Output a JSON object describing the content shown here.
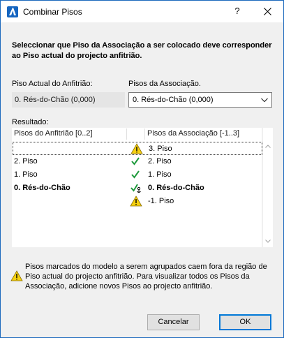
{
  "window": {
    "title": "Combinar Pisos",
    "help": "?"
  },
  "instruction": "Seleccionar que Piso da Associação a ser colocado deve corresponder ao Piso actual do projecto anfitrião.",
  "host_story": {
    "label": "Piso Actual do Anfitrião:",
    "value": "0. Rés-do-Chão (0,000)"
  },
  "assoc_story": {
    "label": "Pisos da Associação.",
    "selected": "0. Rés-do-Chão (0,000)"
  },
  "results": {
    "label": "Resultado:",
    "col_host": "Pisos do Anfitrião [0..2]",
    "col_assoc": "Pisos da Associação [-1..3]",
    "rows": [
      {
        "host": "",
        "status": "warning-icon",
        "assoc": "3. Piso",
        "bold": false
      },
      {
        "host": "2. Piso",
        "status": "check-icon",
        "assoc": "2. Piso",
        "bold": false
      },
      {
        "host": "1. Piso",
        "status": "check-icon",
        "assoc": "1. Piso",
        "bold": false
      },
      {
        "host": "0. Rés-do-Chão",
        "status": "check-anchor-icon",
        "assoc": "0. Rés-do-Chão",
        "bold": true
      },
      {
        "host": "",
        "status": "warning-icon",
        "assoc": "-1. Piso",
        "bold": false
      }
    ]
  },
  "note": "Pisos marcados do modelo a serem agrupados caem fora da região de Piso actual do projecto anfitrião. Para visualizar todos os Pisos da Associação, adicione novos Pisos ao projecto anfitrião.",
  "buttons": {
    "cancel": "Cancelar",
    "ok": "OK"
  },
  "colors": {
    "warning": "#f5d00f",
    "check": "#1e9a3c",
    "accent": "#0078d7"
  }
}
